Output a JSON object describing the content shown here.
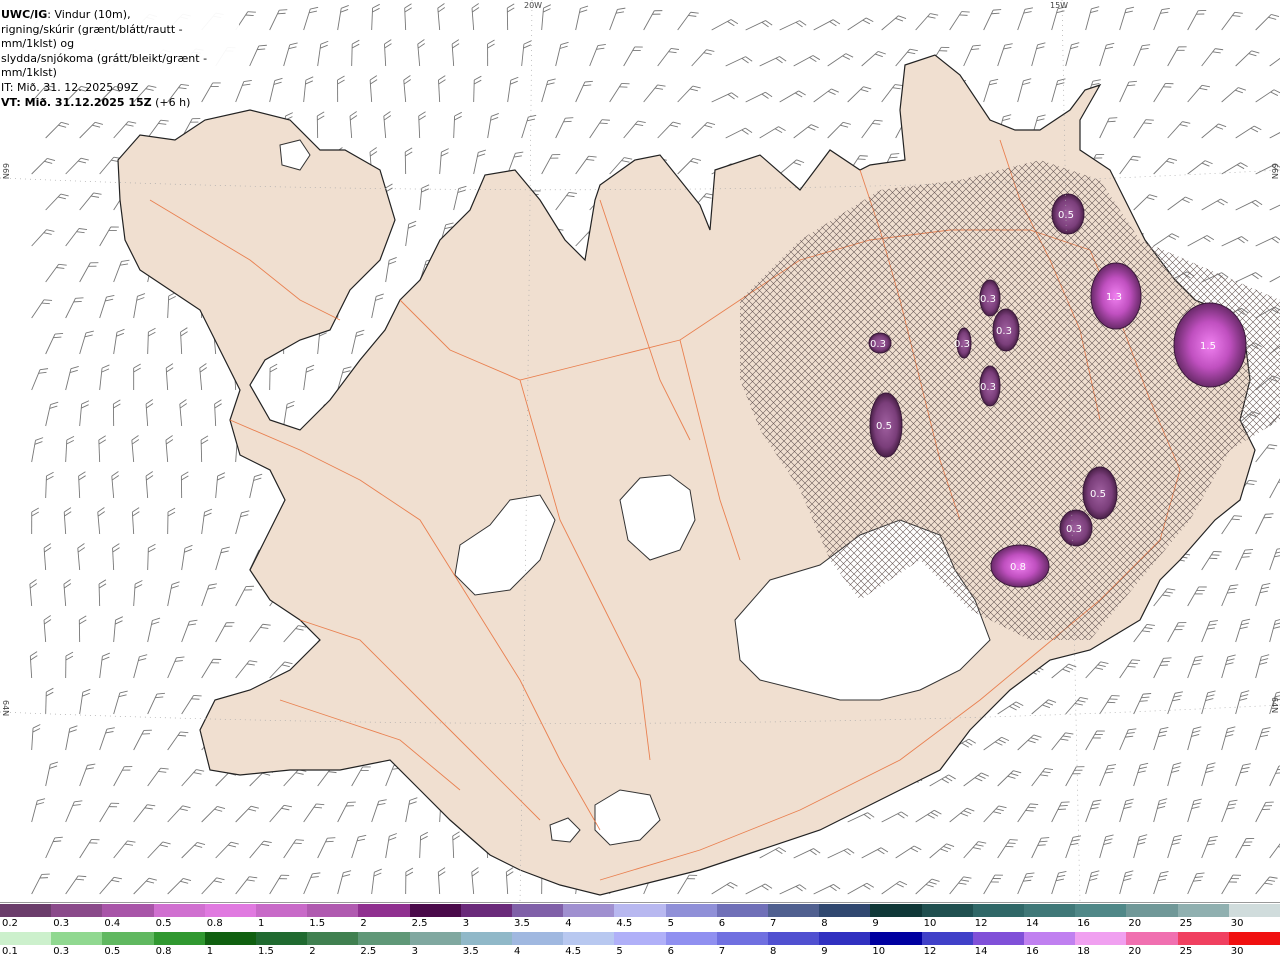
{
  "header": {
    "product": "UWC/IG",
    "line1_rest": ": Vindur (10m),",
    "line2": "rigning/skúrir (grænt/blátt/rautt - mm/1klst) og",
    "line3": "slydda/snjókoma (grátt/bleikt/grænt - mm/1klst)",
    "line4": "IT: Mið. 31. 12. 2025 09Z",
    "line5_bold": "VT: Mið. 31.12.2025 15Z",
    "line5_rest": " (+6 h)"
  },
  "coords": {
    "top_left": "20W",
    "top_right": "15W",
    "left_upper": "66N",
    "left_lower": "64N",
    "right_upper": "66N",
    "right_lower": "64N"
  },
  "precip_labels": [
    "0.5",
    "1.3",
    "0.3",
    "0.3",
    "0.3",
    "0.3",
    "1.5",
    "0.3",
    "0.5",
    "0.5",
    "0.3",
    "0.8"
  ],
  "snow_scale": {
    "labels": [
      "0.2",
      "0.3",
      "0.4",
      "0.5",
      "0.8",
      "1",
      "1.5",
      "2",
      "2.5",
      "3",
      "3.5",
      "4",
      "4.5",
      "5",
      "6",
      "7",
      "8",
      "9",
      "10",
      "12",
      "14",
      "16",
      "20",
      "25",
      "30"
    ],
    "colors": [
      "#6b3d6b",
      "#8a4a8a",
      "#a855a8",
      "#d070d0",
      "#e07ae0",
      "#c86ac8",
      "#b05ab0",
      "#903090",
      "#4a0a4a",
      "#6a2a7a",
      "#8060a8",
      "#a090d0",
      "#b8b8f0",
      "#9090d8",
      "#7070b8",
      "#506090",
      "#304870",
      "#103838",
      "#205050",
      "#306868",
      "#407878",
      "#508888",
      "#709898",
      "#90b0b0",
      "#d0dcdc"
    ]
  },
  "rain_scale": {
    "labels": [
      "0.1",
      "0.3",
      "0.5",
      "0.8",
      "1",
      "1.5",
      "2",
      "2.5",
      "3",
      "3.5",
      "4",
      "4.5",
      "5",
      "6",
      "7",
      "8",
      "9",
      "10",
      "12",
      "14",
      "16",
      "18",
      "20",
      "25",
      "30"
    ],
    "colors": [
      "#ccf0cc",
      "#90d890",
      "#60b860",
      "#309830",
      "#106010",
      "#206a30",
      "#408050",
      "#609878",
      "#80a8a0",
      "#90b8c8",
      "#a0b8e0",
      "#b8c8f0",
      "#b0b0f8",
      "#9090f0",
      "#7070e0",
      "#5050d0",
      "#3030c0",
      "#0000a0",
      "#4040c8",
      "#8050d8",
      "#c080f0",
      "#f0a0f0",
      "#f070b0",
      "#f04060",
      "#f01010"
    ]
  },
  "colors": {
    "land": "#f0dfd0",
    "sea": "#ffffff",
    "roads": "#e8703a",
    "glacier": "#ffffff",
    "hatch": "#6a5a58"
  }
}
